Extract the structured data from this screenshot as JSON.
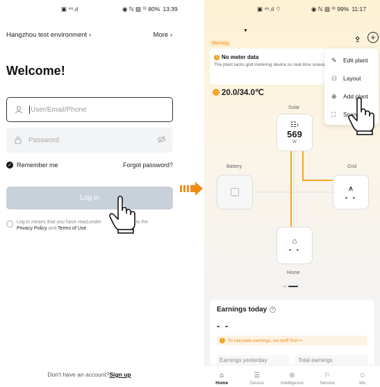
{
  "left": {
    "status": {
      "icons": "▣ ⁴⁶.ıl",
      "right": "◉ ℕ ▨ ⁽ᴵ⁾ 80%",
      "time": "13:39"
    },
    "environment": "Hangzhou test environment",
    "more": "More",
    "welcome": "Welcome!",
    "user_placeholder": "User/Email/Phone",
    "password_placeholder": "Password",
    "remember": "Remember me",
    "forgot": "Forgot password?",
    "login": "Log in",
    "terms_pre": "Log in means that you have read,under",
    "terms_post": "agreed to the",
    "privacy": "Privacy Policy",
    "and": "and",
    "terms_link": "Terms of Use",
    "no_account": "Don't have an account?",
    "sign_up": "Sign up"
  },
  "right": {
    "status": {
      "icons": "▣ ⁴⁶.ıl ⌔",
      "right": "◉ ℕ ▨ ⁽ᴵ⁾ 99%",
      "time": "11:17"
    },
    "warning_tag": "Warning",
    "meter_title": "No meter data",
    "meter_desc": "The plant lacks grid metering device,so real-time unavailable.",
    "weather": "20.0/34.0℃",
    "menu": [
      {
        "icon": "✎",
        "label": "Edit plant"
      },
      {
        "icon": "⚇",
        "label": "Layout"
      },
      {
        "icon": "⊕",
        "label": "Add plant"
      },
      {
        "icon": "⛶",
        "label": "Scan"
      }
    ],
    "solar_label": "Solar",
    "solar_value": "569",
    "solar_unit": "W",
    "battery_label": "Battery",
    "grid_label": "Grid",
    "grid_value": "- -",
    "home_label": "Home",
    "home_value": "- -",
    "earnings_title": "Earnings today",
    "earnings_value": "- -",
    "earnings_tip": "To calculate earnings, set tariff first>>",
    "earnings_yesterday": "Earnings yesterday",
    "total_earnings": "Total earnings",
    "tabs": [
      {
        "icon": "⌂",
        "label": "Home"
      },
      {
        "icon": "☰",
        "label": "Device"
      },
      {
        "icon": "⊛",
        "label": "Intelligence"
      },
      {
        "icon": "⚐",
        "label": "Service"
      },
      {
        "icon": "☺",
        "label": "Me"
      }
    ]
  },
  "colors": {
    "accent": "#f5a623",
    "login_disabled": "#c8d0da",
    "arrow": "#f08b17"
  }
}
